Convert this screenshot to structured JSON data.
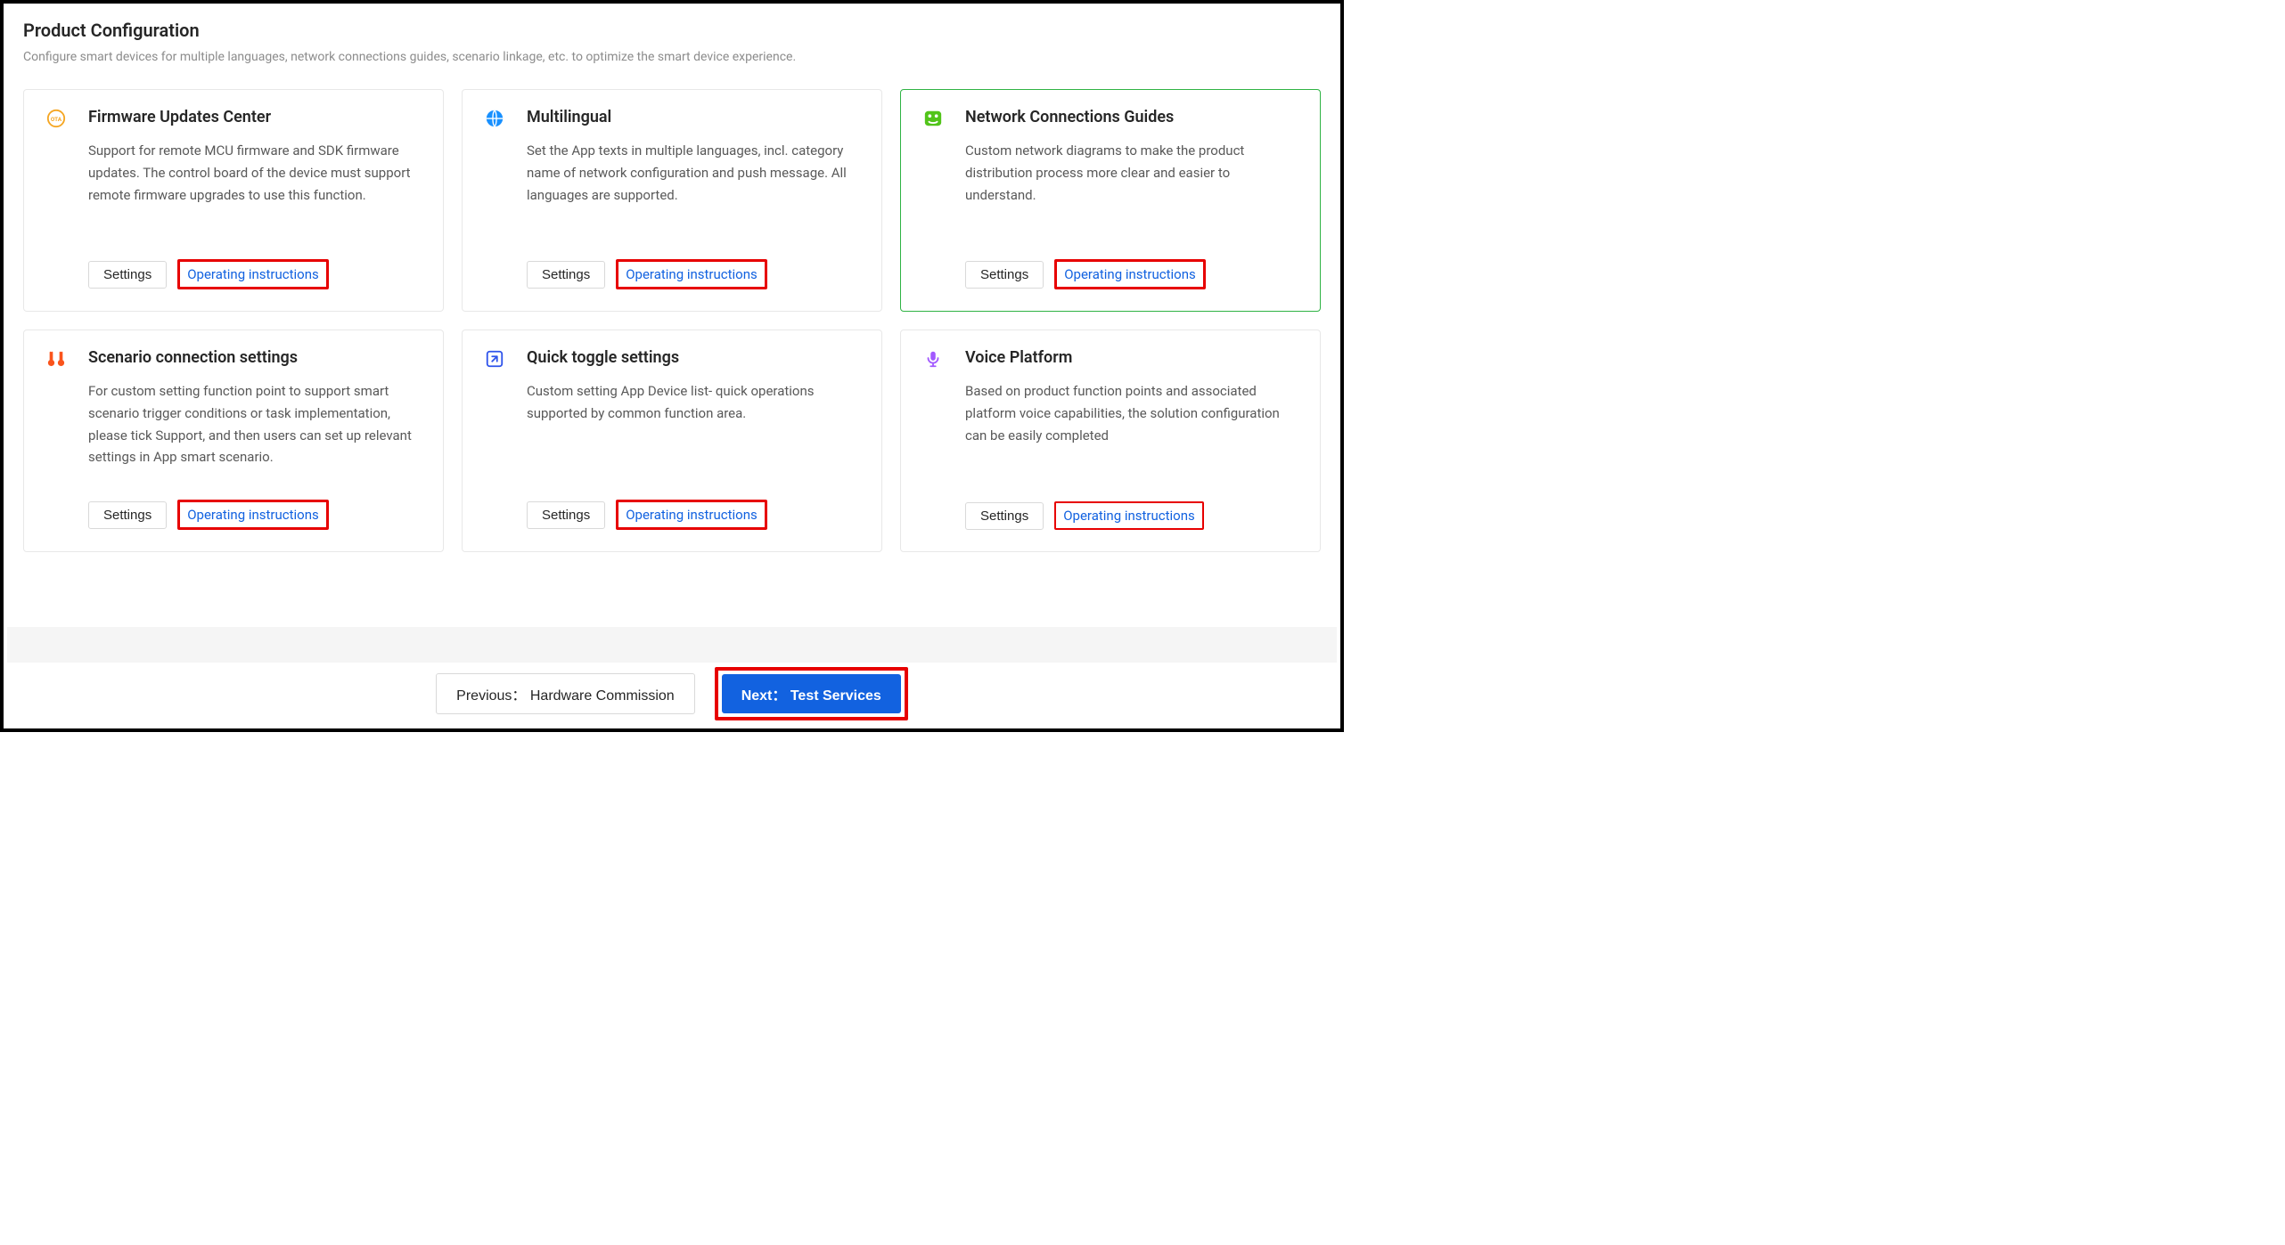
{
  "page": {
    "title": "Product Configuration",
    "subtitle": "Configure smart devices for multiple languages, network connections guides, scenario linkage, etc. to optimize the smart device experience."
  },
  "labels": {
    "settings": "Settings",
    "instructions": "Operating instructions"
  },
  "cards": [
    {
      "icon": "ota-icon",
      "title": "Firmware Updates Center",
      "desc": "Support for remote MCU firmware and SDK firmware updates. The control board of the device must support remote firmware upgrades to use this function.",
      "highlight": false
    },
    {
      "icon": "globe-icon",
      "title": "Multilingual",
      "desc": "Set the App texts in multiple languages, incl. category name of network configuration and push message. All languages are supported.",
      "highlight": false
    },
    {
      "icon": "network-icon",
      "title": "Network Connections Guides",
      "desc": "Custom network diagrams to make the product distribution process more clear and easier to understand.",
      "highlight": true
    },
    {
      "icon": "scenario-icon",
      "title": "Scenario connection settings",
      "desc": "For custom setting function point to support smart scenario trigger conditions or task implementation, please tick Support, and then users can set up relevant settings in App smart scenario.",
      "highlight": false
    },
    {
      "icon": "toggle-icon",
      "title": "Quick toggle settings",
      "desc": "Custom setting App Device list- quick operations supported by common function area.",
      "highlight": false
    },
    {
      "icon": "mic-icon",
      "title": "Voice Platform",
      "desc": "Based on product function points and associated platform voice capabilities, the solution configuration can be easily completed",
      "highlight": false
    }
  ],
  "footer": {
    "prev": "Previous： Hardware Commission",
    "next": "Next： Test Services"
  }
}
